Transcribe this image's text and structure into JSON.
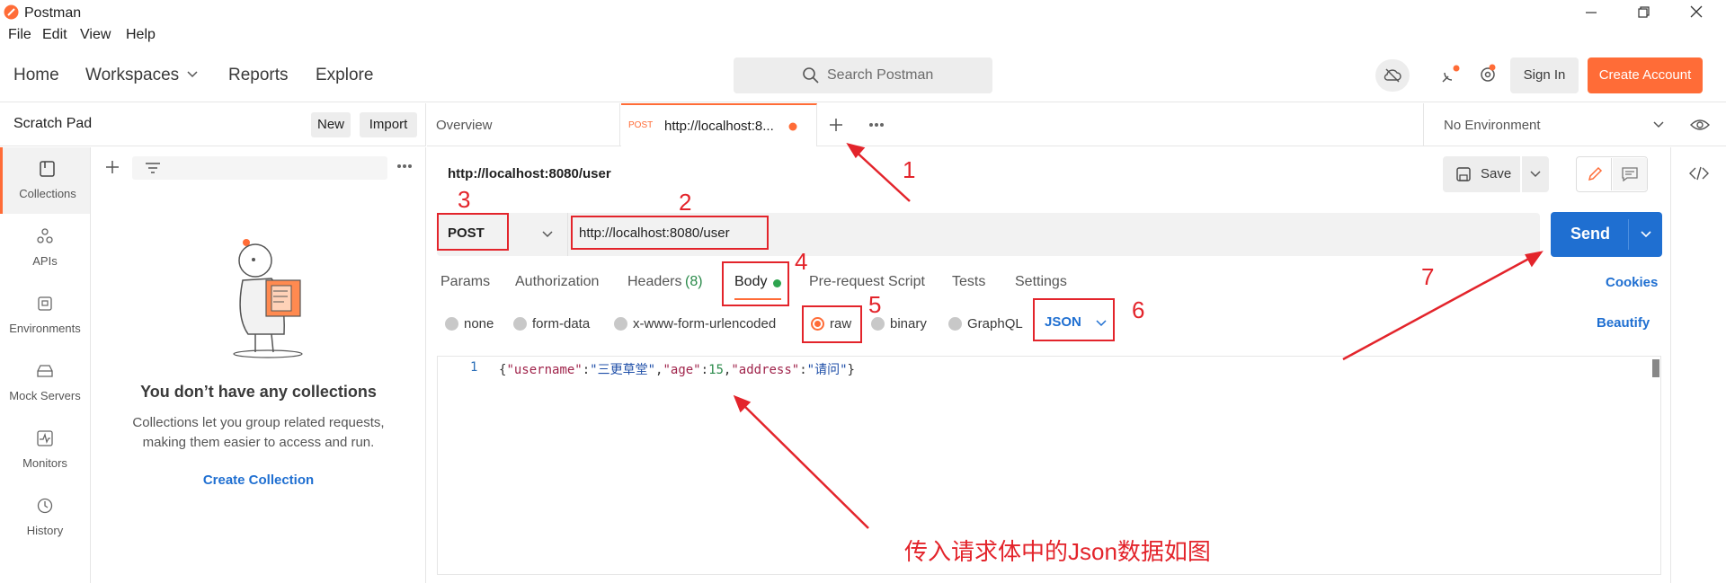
{
  "window": {
    "title": "Postman",
    "menu": [
      "File",
      "Edit",
      "View",
      "Help"
    ]
  },
  "header": {
    "nav": [
      "Home",
      "Workspaces",
      "Reports",
      "Explore"
    ],
    "search_placeholder": "Search Postman",
    "sign_in": "Sign In",
    "create_account": "Create Account",
    "accent_color": "#ff6c37"
  },
  "sidebar": {
    "title": "Scratch Pad",
    "new_label": "New",
    "import_label": "Import",
    "rail": [
      {
        "label": "Collections",
        "icon": "collections-icon",
        "active": true
      },
      {
        "label": "APIs",
        "icon": "apis-icon"
      },
      {
        "label": "Environments",
        "icon": "environments-icon"
      },
      {
        "label": "Mock Servers",
        "icon": "mock-servers-icon"
      },
      {
        "label": "Monitors",
        "icon": "monitors-icon"
      },
      {
        "label": "History",
        "icon": "history-icon"
      }
    ],
    "empty_title": "You don’t have any collections",
    "empty_desc": "Collections let you group related requests, making them easier to access and run.",
    "create_collection": "Create Collection"
  },
  "tabs": {
    "overview": "Overview",
    "active_method": "POST",
    "active_url": "http://localhost:8...",
    "environment": "No Environment"
  },
  "request": {
    "title": "http://localhost:8080/user",
    "save_label": "Save",
    "method": "POST",
    "url": "http://localhost:8080/user",
    "send_label": "Send",
    "tabs": [
      "Params",
      "Authorization",
      "Headers",
      "Body",
      "Pre-request Script",
      "Tests",
      "Settings"
    ],
    "headers_count": "(8)",
    "cookies": "Cookies",
    "beautify": "Beautify",
    "body_modes": [
      "none",
      "form-data",
      "x-www-form-urlencoded",
      "raw",
      "binary",
      "GraphQL"
    ],
    "selected_mode": "raw",
    "body_type": "JSON",
    "line_number": "1",
    "code": {
      "open": "{",
      "k1": "\"username\"",
      "v1": "\"三更草堂\"",
      "k2": "\"age\"",
      "v2": "15",
      "k3": "\"address\"",
      "v3": "\"请问\"",
      "close": "}"
    }
  },
  "annotations": {
    "numbers": [
      "1",
      "2",
      "3",
      "4",
      "5",
      "6",
      "7"
    ],
    "caption": "传入请求体中的Json数据如图",
    "color": "#e3242b"
  }
}
